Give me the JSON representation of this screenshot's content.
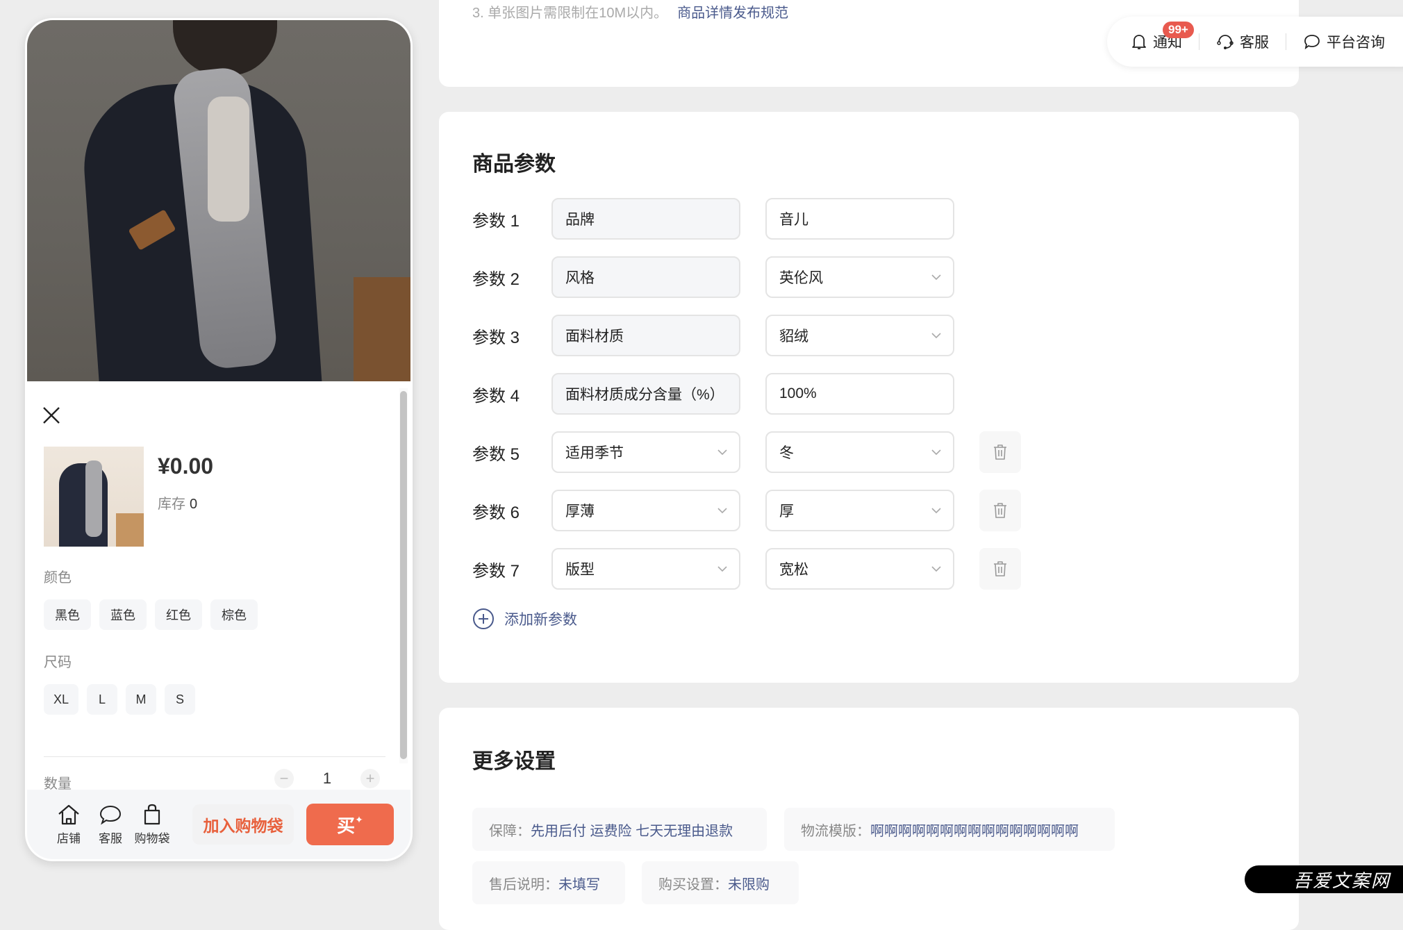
{
  "preview": {
    "price": "¥0.00",
    "stock_label": "库存",
    "stock_value": "0",
    "color_label": "颜色",
    "colors": [
      "黑色",
      "蓝色",
      "红色",
      "棕色"
    ],
    "size_label": "尺码",
    "sizes": [
      "XL",
      "L",
      "M",
      "S"
    ],
    "quantity_label": "数量",
    "quantity_value": "1",
    "bottom_nav": [
      {
        "label": "店铺",
        "icon": "home-icon"
      },
      {
        "label": "客服",
        "icon": "chat-bubble-icon"
      },
      {
        "label": "购物袋",
        "icon": "shopping-bag-icon"
      }
    ],
    "add_to_cart_label": "加入购物袋",
    "buy_label": "买",
    "accent_color": "#ef6b4d"
  },
  "upload_hint": {
    "text": "3. 单张图片需限制在10M以内。",
    "link": "商品详情发布规范"
  },
  "toolbar": {
    "notify_label": "通知",
    "notify_badge": "99+",
    "service_label": "客服",
    "consult_label": "平台咨询"
  },
  "params_section": {
    "title": "商品参数",
    "rows": [
      {
        "label": "参数 1",
        "key": "品牌",
        "key_type": "readonly",
        "value": "音儿",
        "value_type": "text",
        "deletable": false
      },
      {
        "label": "参数 2",
        "key": "风格",
        "key_type": "readonly",
        "value": "英伦风",
        "value_type": "select",
        "deletable": false
      },
      {
        "label": "参数 3",
        "key": "面料材质",
        "key_type": "readonly",
        "value": "貂绒",
        "value_type": "select",
        "deletable": false
      },
      {
        "label": "参数 4",
        "key": "面料材质成分含量（%）",
        "key_type": "readonly",
        "value": "100%",
        "value_type": "text",
        "deletable": false
      },
      {
        "label": "参数 5",
        "key": "适用季节",
        "key_type": "select",
        "value": "冬",
        "value_type": "select",
        "deletable": true
      },
      {
        "label": "参数 6",
        "key": "厚薄",
        "key_type": "select",
        "value": "厚",
        "value_type": "select",
        "deletable": true
      },
      {
        "label": "参数 7",
        "key": "版型",
        "key_type": "select",
        "value": "宽松",
        "value_type": "select",
        "deletable": true
      }
    ],
    "add_label": "添加新参数"
  },
  "more_section": {
    "title": "更多设置",
    "items": [
      {
        "key": "保障：",
        "value": "先用后付 运费险 七天无理由退款"
      },
      {
        "key": "物流模版：",
        "value": "啊啊啊啊啊啊啊啊啊啊啊啊啊啊啊"
      },
      {
        "key": "售后说明：",
        "value": "未填写"
      },
      {
        "key": "购买设置：",
        "value": "未限购"
      }
    ]
  },
  "watermark": "吾爱文案网"
}
